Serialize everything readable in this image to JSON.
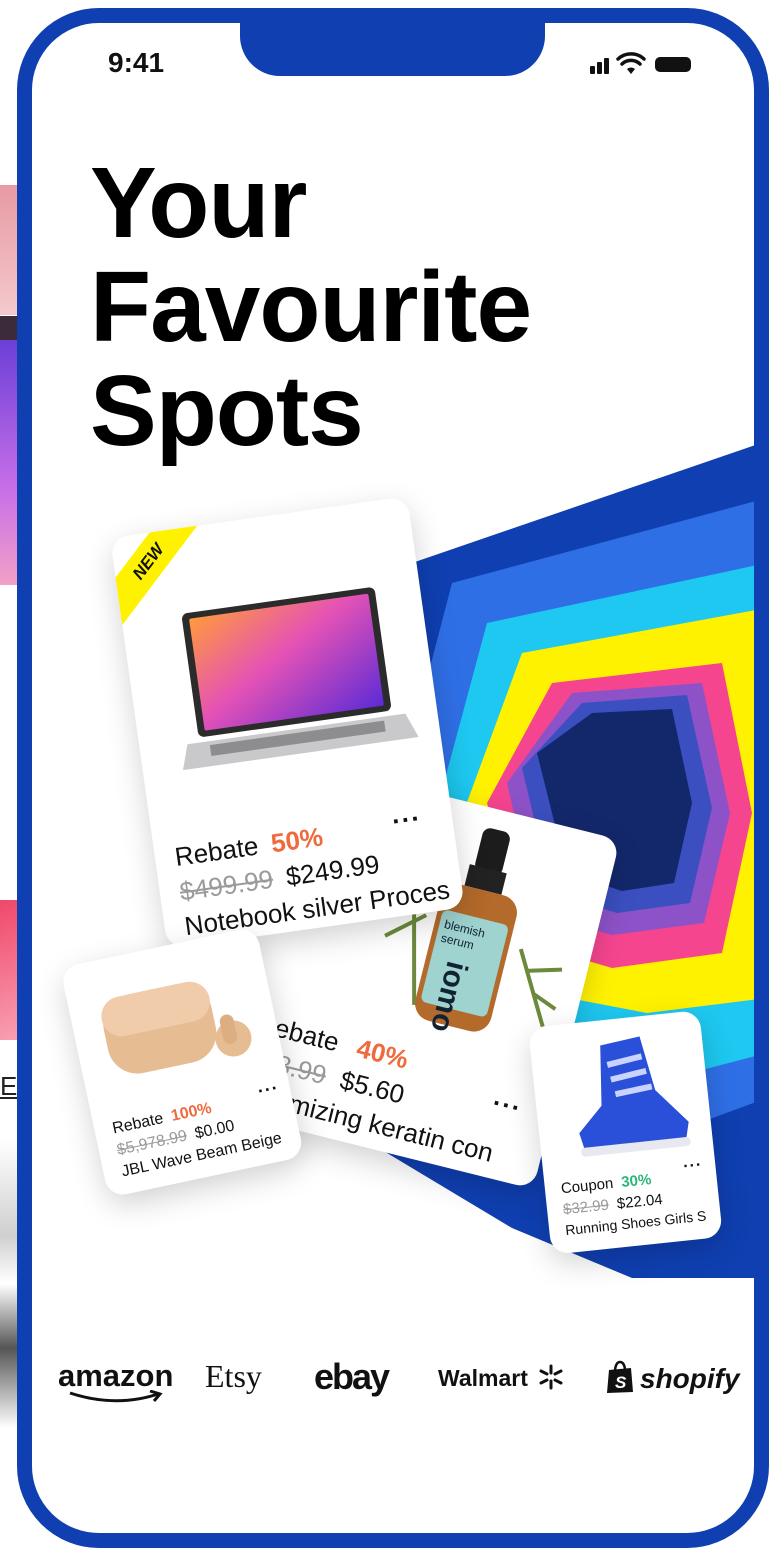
{
  "status_bar": {
    "time": "9:41"
  },
  "headline": {
    "line1": "Your",
    "line2": "Favourite",
    "line3": "Spots"
  },
  "peek": {
    "letter": "E"
  },
  "cards": {
    "notebook": {
      "badge": "NEW",
      "label": "Rebate",
      "percent": "50%",
      "old_price": "$499.99",
      "price": "$249.99",
      "title": "Notebook silver Proces",
      "more": "···"
    },
    "serum": {
      "label": "Rebate",
      "percent": "40%",
      "old_price": "$13.99",
      "price": "$5.60",
      "title": "Volumizing keratin con",
      "more": "···",
      "bottle_text1": "blemish",
      "bottle_text2": "serum",
      "bottle_brand": "iomo"
    },
    "earbuds": {
      "label": "Rebate",
      "percent": "100%",
      "old_price": "$5,978.99",
      "price": "$0.00",
      "title": "JBL Wave Beam Beige",
      "more": "···"
    },
    "shoes": {
      "label": "Coupon",
      "percent": "30%",
      "old_price": "$32.99",
      "price": "$22.04",
      "title": "Running Shoes Girls S",
      "more": "···"
    }
  },
  "brands": [
    "amazon",
    "Etsy",
    "ebay",
    "Walmart",
    "shopify"
  ],
  "colors": {
    "frame": "#0f3fb1",
    "rebate_accent": "#ef6a3c",
    "coupon_accent": "#2cb67a"
  }
}
